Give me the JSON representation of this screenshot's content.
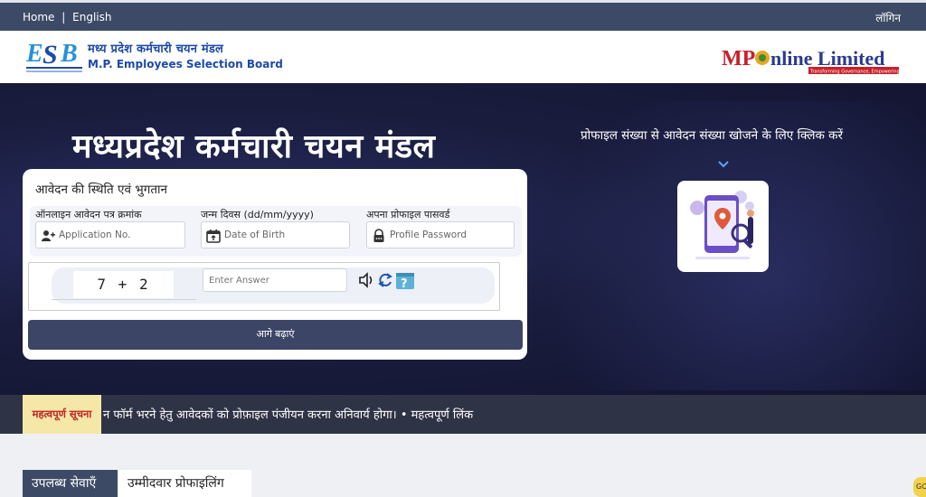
{
  "topnav": {
    "home_label": "Home",
    "separator": "|",
    "language_label": "English",
    "login_label": "लॉगिन"
  },
  "header": {
    "esb_logo_text": "ESB",
    "org_name_hi": "मध्य प्रदेश कर्मचारी चयन मंडल",
    "org_name_en": "M.P. Employees Selection Board",
    "mponline_text": "MPOnline Limited",
    "mponline_tagline": "Transforming Governance, Empowering Citizens"
  },
  "hero": {
    "title": "मध्यप्रदेश कर्मचारी चयन मंडल",
    "form": {
      "title": "आवेदन की स्थिति एवं भुगतान",
      "application_label": "ऑनलाइन आवेदन पत्र क्रमांक",
      "application_placeholder": "Application No.",
      "dob_label": "जन्म दिवस (dd/mm/yyyy)",
      "dob_placeholder": "Date of Birth",
      "password_label": "अपना प्रोफाइल पासवर्ड",
      "password_placeholder": "Profile Password",
      "captcha_code": "7 + 2",
      "answer_placeholder": "Enter Answer",
      "submit_label": "आगे बढ़ाएं"
    },
    "lookup": {
      "text": "प्रोफाइल संख्या से आवेदन संख्या खोजने के लिए क्लिक करें"
    }
  },
  "ticker": {
    "badge": "महत्वपूर्ण सूचना",
    "message": "न फॉर्म भरने हेतु आवेदकों को प्रोफ़ाइल पंजीयन करना अनिवार्य होगा। • महत्वपूर्ण लिंक"
  },
  "tabs": [
    {
      "label": "उपलब्ध सेवाएँ"
    },
    {
      "label": "उम्मीदवार प्रोफाइलिंग"
    }
  ],
  "fab": {
    "label": "GO"
  },
  "colors": {
    "nav_bg": "#3d4a66",
    "hero_bg": "#1a1d3e",
    "accent_blue": "#1d4aa8",
    "badge_bg": "#f4e7a8",
    "badge_text": "#c02222"
  }
}
